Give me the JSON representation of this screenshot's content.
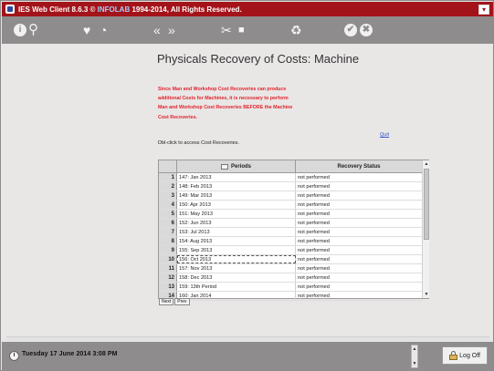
{
  "window": {
    "title_prefix": "IES Web Client 8.6.3 © ",
    "title_brand": "INFOLAB",
    "title_suffix": " 1994-2014, All Rights Reserved."
  },
  "toolbar": {
    "info_glyph": "i",
    "search_glyph": "⚲",
    "favorite_glyph": "♥",
    "history_glyph": "◔",
    "back_glyph": "«",
    "forward_glyph": "»",
    "tools_glyph": "✂",
    "stop_glyph": "■",
    "refresh_glyph": "♻",
    "ok_glyph": "✔",
    "cancel_glyph": "✖"
  },
  "page": {
    "title": "Physicals Recovery of Costs: Machine",
    "warning": "Since Man and Workshop Cost Recoveries can produce additional Costs for Machines, it is necessary to perform Man and Workshop Cost Recoveries BEFORE the Machine Cost Recoveries.",
    "quit_label": "Quit",
    "hint": "Dbl-click to access Cost Recoveries."
  },
  "table": {
    "columns": [
      "Periods",
      "Recovery Status"
    ],
    "rows": [
      {
        "num": "1",
        "period": "147: Jan 2013",
        "status": "not performed"
      },
      {
        "num": "2",
        "period": "148: Feb 2013",
        "status": "not performed"
      },
      {
        "num": "3",
        "period": "149: Mar 2013",
        "status": "not performed"
      },
      {
        "num": "4",
        "period": "150: Apr 2013",
        "status": "not performed"
      },
      {
        "num": "5",
        "period": "151: May 2013",
        "status": "not performed"
      },
      {
        "num": "6",
        "period": "152: Jun 2013",
        "status": "not performed"
      },
      {
        "num": "7",
        "period": "153: Jul 2013",
        "status": "not performed"
      },
      {
        "num": "8",
        "period": "154: Aug 2013",
        "status": "not performed"
      },
      {
        "num": "9",
        "period": "155: Sep 2013",
        "status": "not performed"
      },
      {
        "num": "10",
        "period": "156: Oct 2013",
        "status": "not performed"
      },
      {
        "num": "11",
        "period": "157: Nov 2013",
        "status": "not performed"
      },
      {
        "num": "12",
        "period": "158: Dec 2013",
        "status": "not performed"
      },
      {
        "num": "13",
        "period": "159: 13th Period",
        "status": "not performed"
      },
      {
        "num": "14",
        "period": "160: Jan 2014",
        "status": "not performed"
      }
    ],
    "selected_row": "10",
    "next_label": "Next",
    "prev_label": "Prev"
  },
  "statusbar": {
    "datetime": "Tuesday 17 June 2014 3:08 PM",
    "logoff_label": "Log Off"
  },
  "colors": {
    "titlebar": "#a3141a",
    "toolbar": "#8e8c8c",
    "warning_text": "#e0242c",
    "link": "#2e58c8"
  }
}
